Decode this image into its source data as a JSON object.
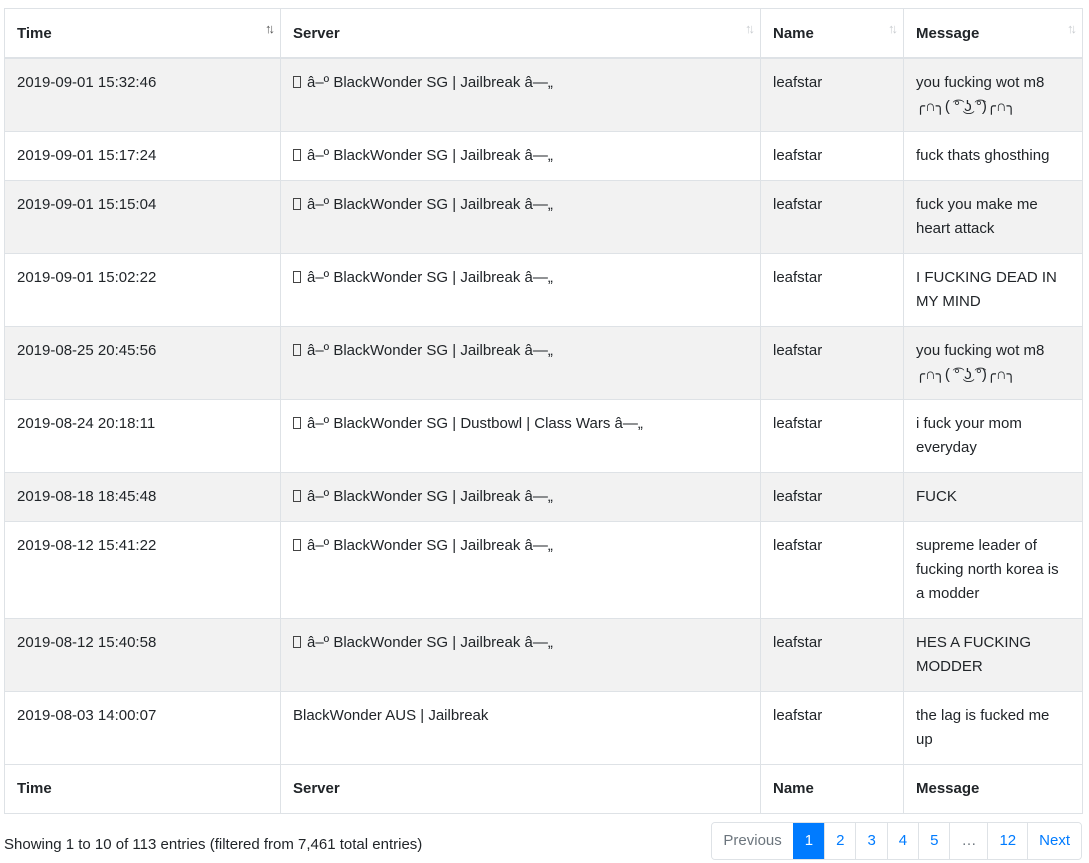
{
  "table": {
    "columns": [
      "Time",
      "Server",
      "Name",
      "Message"
    ],
    "rows": [
      {
        "time": "2019-09-01 15:32:46",
        "server": "â–º BlackWonder SG | Jailbreak â—„",
        "server_glyph": true,
        "name": "leafstar",
        "message": "you fucking wot m8 ╭∩╮( ͡° ͜ʖ ͡°)╭∩╮"
      },
      {
        "time": "2019-09-01 15:17:24",
        "server": "â–º BlackWonder SG | Jailbreak â—„",
        "server_glyph": true,
        "name": "leafstar",
        "message": "fuck thats ghosthing"
      },
      {
        "time": "2019-09-01 15:15:04",
        "server": "â–º BlackWonder SG | Jailbreak â—„",
        "server_glyph": true,
        "name": "leafstar",
        "message": "fuck you make me heart attack"
      },
      {
        "time": "2019-09-01 15:02:22",
        "server": "â–º BlackWonder SG | Jailbreak â—„",
        "server_glyph": true,
        "name": "leafstar",
        "message": "I FUCKING DEAD IN MY MIND"
      },
      {
        "time": "2019-08-25 20:45:56",
        "server": "â–º BlackWonder SG | Jailbreak â—„",
        "server_glyph": true,
        "name": "leafstar",
        "message": "you fucking wot m8 ╭∩╮( ͡° ͜ʖ ͡°)╭∩╮"
      },
      {
        "time": "2019-08-24 20:18:11",
        "server": "â–º BlackWonder SG | Dustbowl | Class Wars â—„",
        "server_glyph": true,
        "name": "leafstar",
        "message": "i fuck your mom everyday"
      },
      {
        "time": "2019-08-18 18:45:48",
        "server": "â–º BlackWonder SG | Jailbreak â—„",
        "server_glyph": true,
        "name": "leafstar",
        "message": "FUCK"
      },
      {
        "time": "2019-08-12 15:41:22",
        "server": "â–º BlackWonder SG | Jailbreak â—„",
        "server_glyph": true,
        "name": "leafstar",
        "message": "supreme leader of fucking north korea is a modder"
      },
      {
        "time": "2019-08-12 15:40:58",
        "server": "â–º BlackWonder SG | Jailbreak â—„",
        "server_glyph": true,
        "name": "leafstar",
        "message": "HES A FUCKING MODDER"
      },
      {
        "time": "2019-08-03 14:00:07",
        "server": "BlackWonder AUS | Jailbreak",
        "server_glyph": false,
        "name": "leafstar",
        "message": "the lag is fucked me up"
      }
    ],
    "sort": {
      "column": "Time",
      "direction": "desc"
    }
  },
  "info": {
    "text": "Showing 1 to 10 of 113 entries (filtered from 7,461 total entries)"
  },
  "pagination": {
    "previous_label": "Previous",
    "next_label": "Next",
    "pages": [
      "1",
      "2",
      "3",
      "4",
      "5",
      "…",
      "12"
    ],
    "active_page": "1"
  },
  "colors": {
    "accent": "#007bff",
    "row_striped": "#f2f2f2",
    "border": "#dee2e6"
  }
}
